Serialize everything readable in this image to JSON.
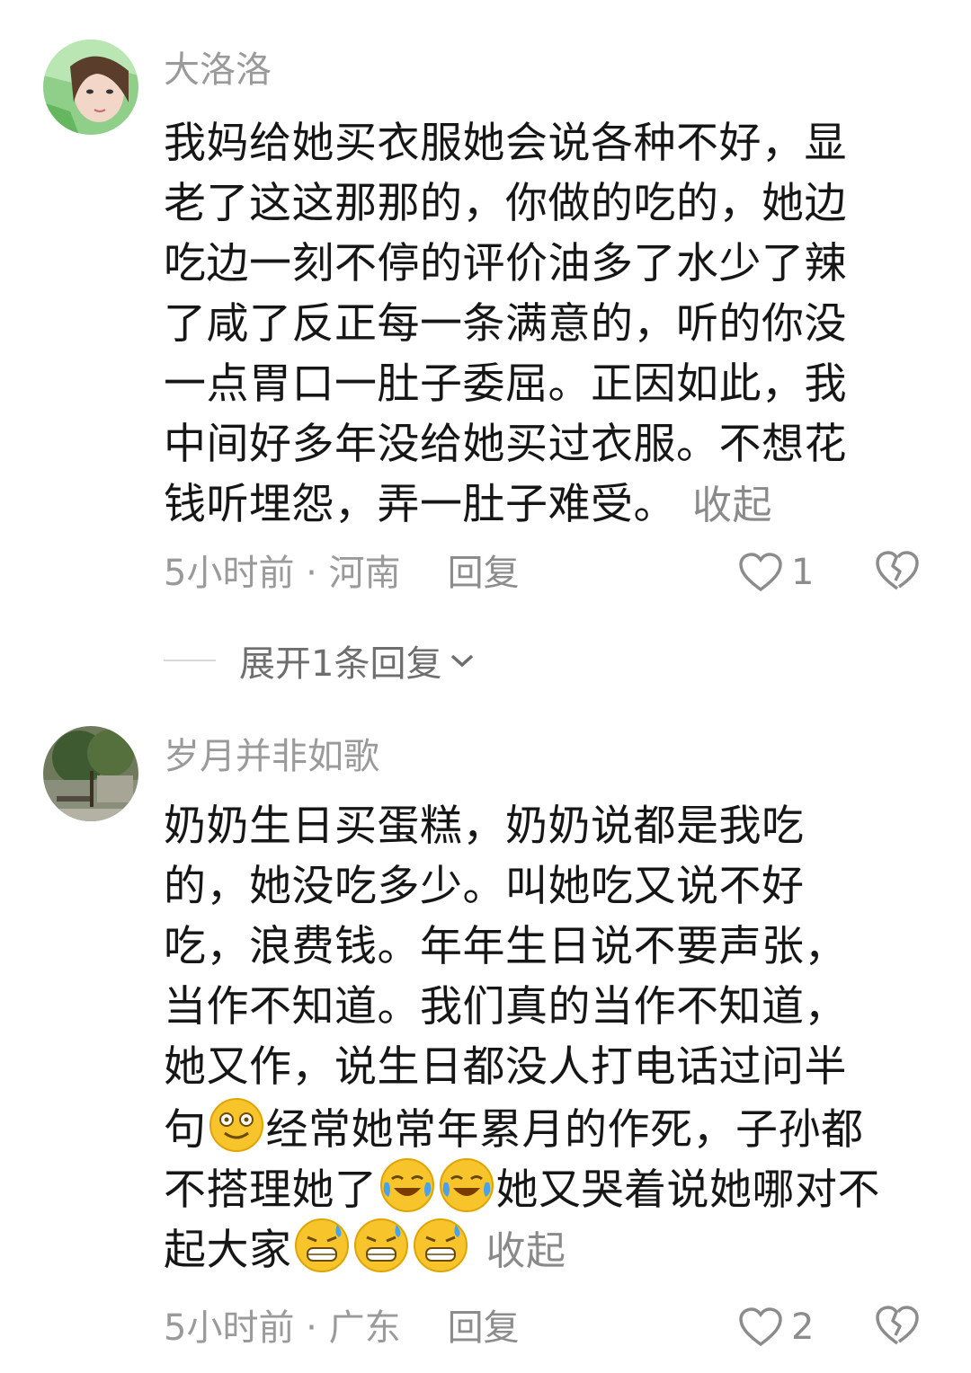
{
  "comments": [
    {
      "username": "大洛洛",
      "lines": [
        "我妈给她买衣服她会说各种不好，显",
        "老了这这那那的，你做的吃的，她边",
        "吃边一刻不停的评价油多了水少了辣",
        "了咸了反正每一条满意的，听的你没",
        "一点胃口一肚子委屈。正因如此，我",
        "中间好多年没给她买过衣服。不想花",
        "钱听埋怨，弄一肚子难受。"
      ],
      "collapse_label": "收起",
      "time": "5小时前",
      "location": "河南",
      "reply_label": "回复",
      "like_count": "1",
      "expand_label": "展开1条回复"
    },
    {
      "username": "岁月并非如歌",
      "lines": [
        "奶奶生日买蛋糕，奶奶说都是我吃",
        "的，她没吃多少。叫她吃又说不好",
        "吃，浪费钱。年年生日说不要声张，",
        "当作不知道。我们真的当作不知道，",
        "她又作，说生日都没人打电话过问半"
      ],
      "line6_a": "句",
      "line6_b": "经常她常年累月的作死，子孙都",
      "line7_a": "不搭理她了",
      "line7_b": "她又哭着说她哪对不",
      "line8_a": "起大家",
      "collapse_label": "收起",
      "time": "5小时前",
      "location": "广东",
      "reply_label": "回复",
      "like_count": "2"
    }
  ],
  "icons": {
    "like": "heart-outline-icon",
    "dislike": "broken-heart-icon",
    "expand": "chevron-down-icon",
    "emoji_smile": "dizzy-smile-emoji",
    "emoji_laugh_cry": "laugh-cry-emoji",
    "emoji_sweat": "grin-sweat-emoji"
  },
  "colors": {
    "text": "#161616",
    "muted": "#9a9a9a",
    "emoji": "#f7c52b"
  }
}
